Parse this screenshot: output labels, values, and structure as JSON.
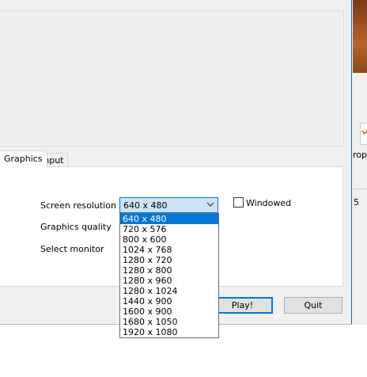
{
  "tabs": [
    "Graphics",
    "Input"
  ],
  "settings": {
    "screen_resolution_label": "Screen resolution",
    "graphics_quality_label": "Graphics quality",
    "select_monitor_label": "Select monitor",
    "resolution_value": "640 x 480",
    "windowed_label": "Windowed",
    "windowed_checked": false
  },
  "resolution_options": [
    "640 x 480",
    "720 x 576",
    "800 x 600",
    "1024 x 768",
    "1280 x 720",
    "1280 x 800",
    "1280 x 960",
    "1280 x 1024",
    "1440 x 900",
    "1600 x 900",
    "1680 x 1050",
    "1920 x 1080"
  ],
  "buttons": {
    "play": "Play!",
    "quit": "Quit"
  },
  "background": {
    "text_a": "rop",
    "text_b": "5"
  },
  "colors": {
    "accent": "#0078d7",
    "selected_bg": "#cce4f7"
  }
}
